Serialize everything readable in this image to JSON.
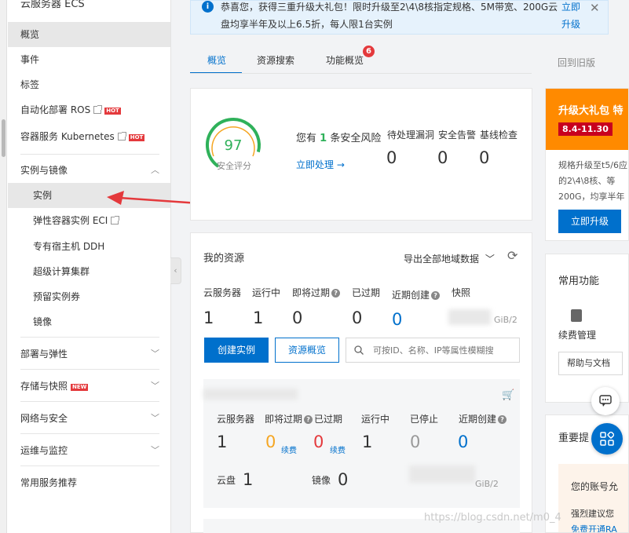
{
  "sidebar": {
    "title": "云服务器 ECS",
    "items": [
      {
        "label": "概览"
      },
      {
        "label": "事件"
      },
      {
        "label": "标签"
      },
      {
        "label": "自动化部署 ROS",
        "hot": "HOT"
      },
      {
        "label": "容器服务 Kubernetes",
        "hot": "HOT"
      }
    ],
    "group_instances": "实例与镜像",
    "sub_items": [
      {
        "label": "实例"
      },
      {
        "label": "弹性容器实例 ECI"
      },
      {
        "label": "专有宿主机 DDH"
      },
      {
        "label": "超级计算集群"
      },
      {
        "label": "预留实例券"
      },
      {
        "label": "镜像"
      }
    ],
    "groups": [
      {
        "label": "部署与弹性"
      },
      {
        "label": "存储与快照",
        "badge": "NEW"
      },
      {
        "label": "网络与安全"
      },
      {
        "label": "运维与监控"
      },
      {
        "label": "常用服务推荐"
      }
    ]
  },
  "notice": {
    "text": "恭喜您，获得三重升级大礼包！限时升级至2\\4\\8核指定规格、5M带宽、200G云盘均享半年及以上6.5折，每人限1台实例",
    "link": "立即升级"
  },
  "tabs": [
    {
      "label": "概览"
    },
    {
      "label": "资源搜索"
    },
    {
      "label": "功能概览",
      "badge": "6"
    }
  ],
  "old_version": "回到旧版",
  "security": {
    "score": "97",
    "score_label": "安全评分",
    "risk_prefix": "您有",
    "risk_count": "1",
    "risk_suffix": "条安全风险",
    "action": "立即处理 →",
    "cols": [
      {
        "label": "待处理漏洞",
        "value": "0"
      },
      {
        "label": "安全告警",
        "value": "0"
      },
      {
        "label": "基线检查",
        "value": "0"
      }
    ]
  },
  "resources": {
    "title": "我的资源",
    "export": "导出全部地域数据",
    "cols": [
      {
        "label": "云服务器",
        "value": "1"
      },
      {
        "label": "运行中",
        "value": "1"
      },
      {
        "label": "即将过期",
        "value": "0"
      },
      {
        "label": "已过期",
        "value": "0"
      },
      {
        "label": "近期创建",
        "value": "0"
      },
      {
        "label": "快照",
        "value": "GiB/2"
      }
    ],
    "create_btn": "创建实例",
    "overview_btn": "资源概览",
    "search_placeholder": "可按ID、名称、IP等属性模糊搜",
    "region": {
      "cols": [
        {
          "label": "云服务器",
          "value": "1"
        },
        {
          "label": "即将过期",
          "value": "0",
          "renew": "续费"
        },
        {
          "label": "已过期",
          "value": "0",
          "renew": "续费"
        },
        {
          "label": "运行中",
          "value": "1"
        },
        {
          "label": "已停止",
          "value": "0"
        },
        {
          "label": "近期创建",
          "value": "0"
        }
      ],
      "disk_label": "云盘",
      "disk_value": "1",
      "image_label": "镜像",
      "image_value": "0",
      "snap_value": "GiB/2"
    }
  },
  "promo": {
    "title": "升级大礼包 特",
    "date": "8.4-11.30",
    "body": "规格升级至t5/6应的2\\4\\8核、等200G，均享半年",
    "btn": "立即升级"
  },
  "common": {
    "title": "常用功能",
    "renew": "续费管理",
    "help": "帮助与文档"
  },
  "reminder": {
    "title": "重要提",
    "line1": "您的账号允",
    "line2": "强烈建议您",
    "line3": "免费开通RA"
  },
  "watermark": "https://blog.csdn.net/m0_4",
  "colors": {
    "primary": "#0070cc",
    "danger": "#e4393c",
    "warning": "#f5a623",
    "promo": "#ff8a00"
  }
}
